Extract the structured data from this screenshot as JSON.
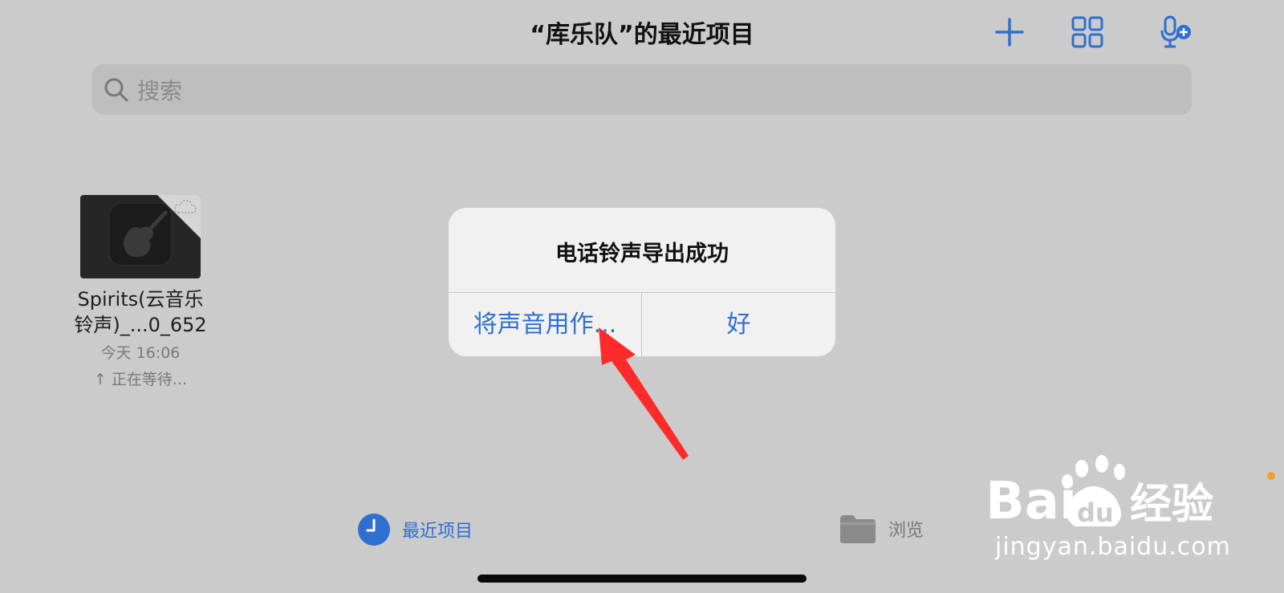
{
  "header": {
    "title": "“库乐队”的最近项目",
    "add_icon": "plus-icon",
    "grid_icon": "grid-view-icon",
    "mic_icon": "microphone-add-icon"
  },
  "search": {
    "placeholder": "搜索",
    "value": ""
  },
  "project": {
    "name_line1": "Spirits(云音乐",
    "name_line2": "铃声)_...0_652",
    "time": "今天 16:06",
    "status": "↑ 正在等待...",
    "icon": "guitar-icon",
    "cloud_icon": "cloud-icon"
  },
  "alert": {
    "title": "电话铃声导出成功",
    "use_sound_button": "将声音用作...",
    "ok_button": "好"
  },
  "tabs": {
    "recent": "最近项目",
    "browse": "浏览"
  },
  "watermark": {
    "brand": "Bai",
    "brand_du": "du",
    "brand_cn": "经验",
    "url": "jingyan.baidu.com"
  },
  "colors": {
    "accent": "#2f6fcf",
    "background": "#cbcbcb",
    "annotation_arrow": "#ff2a2a"
  }
}
